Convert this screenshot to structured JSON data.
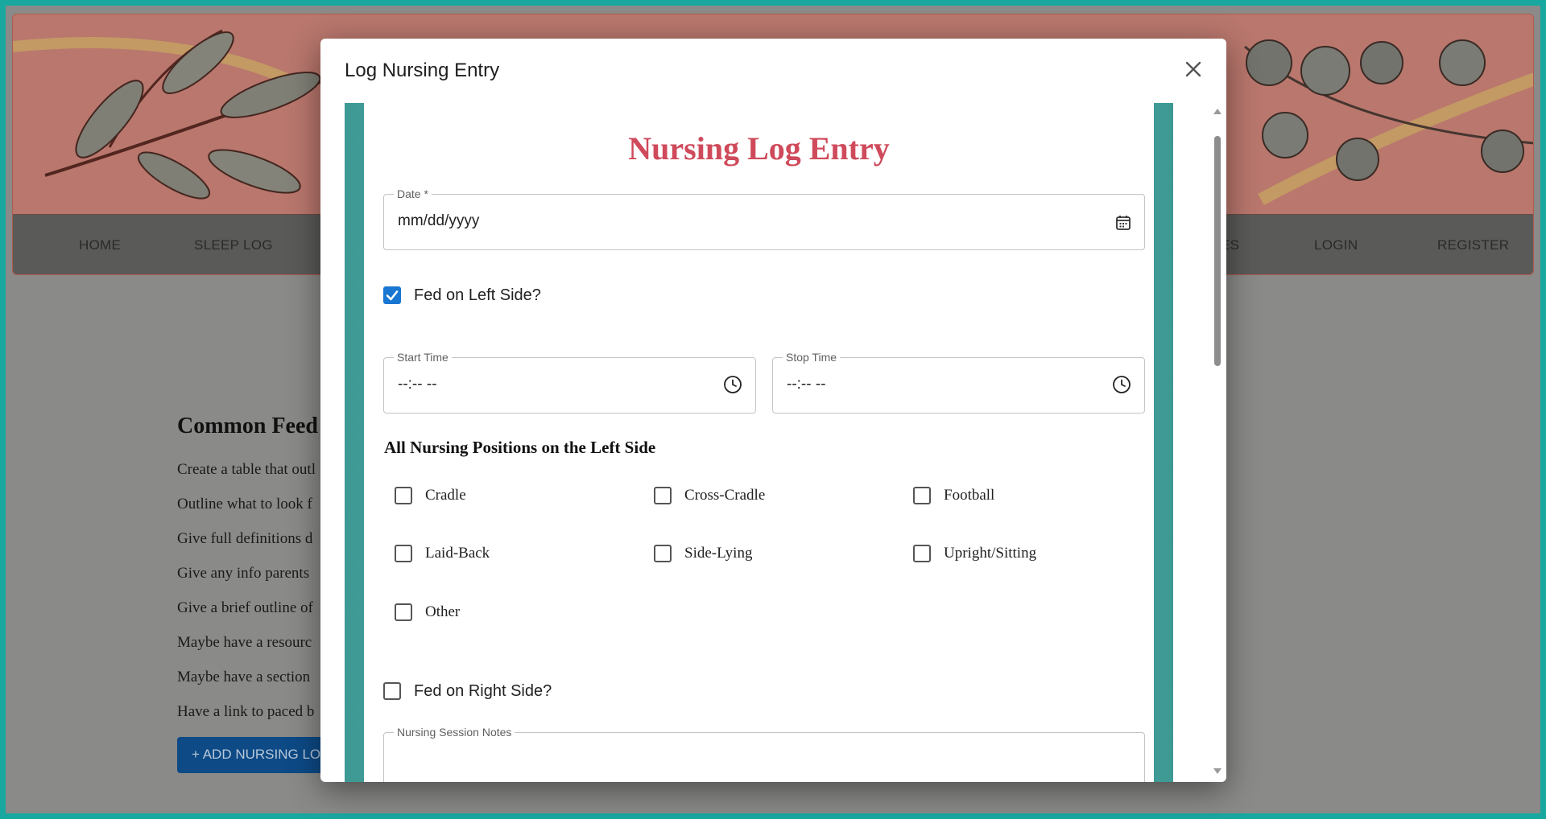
{
  "background_page": {
    "nav_items": [
      "HOME",
      "SLEEP LOG",
      "ES",
      "LOGIN",
      "REGISTER"
    ],
    "content_title": "Common Feed",
    "content_lines": [
      "Create a table that outl",
      "Outline what to look f",
      "Give full definitions d",
      "Give any info parents",
      "Give a brief outline of",
      "Maybe have a resourc",
      "Maybe have a section",
      "Have a link to paced b"
    ],
    "add_button_label": "+ ADD NURSING LO"
  },
  "modal": {
    "title": "Log Nursing Entry",
    "close_icon": "close-icon"
  },
  "form": {
    "heading": "Nursing Log Entry",
    "date": {
      "label": "Date *",
      "value": "mm/dd/yyyy",
      "icon": "calendar-icon"
    },
    "fed_left": {
      "label": "Fed on Left Side?",
      "checked": true
    },
    "start_time": {
      "label": "Start Time",
      "value": "--:-- --",
      "icon": "clock-icon"
    },
    "stop_time": {
      "label": "Stop Time",
      "value": "--:-- --",
      "icon": "clock-icon"
    },
    "left_positions": {
      "heading": "All Nursing Positions on the Left Side",
      "options": [
        {
          "label": "Cradle",
          "checked": false
        },
        {
          "label": "Cross-Cradle",
          "checked": false
        },
        {
          "label": "Football",
          "checked": false
        },
        {
          "label": "Laid-Back",
          "checked": false
        },
        {
          "label": "Side-Lying",
          "checked": false
        },
        {
          "label": "Upright/Sitting",
          "checked": false
        },
        {
          "label": "Other",
          "checked": false
        }
      ]
    },
    "fed_right": {
      "label": "Fed on Right Side?",
      "checked": false
    },
    "notes": {
      "label": "Nursing Session Notes",
      "value": ""
    }
  },
  "colors": {
    "accent": "#1976d2",
    "heading": "#cf4a5b",
    "teal_frame": "#4fa7a2",
    "outer_border": "#19a8a0"
  }
}
